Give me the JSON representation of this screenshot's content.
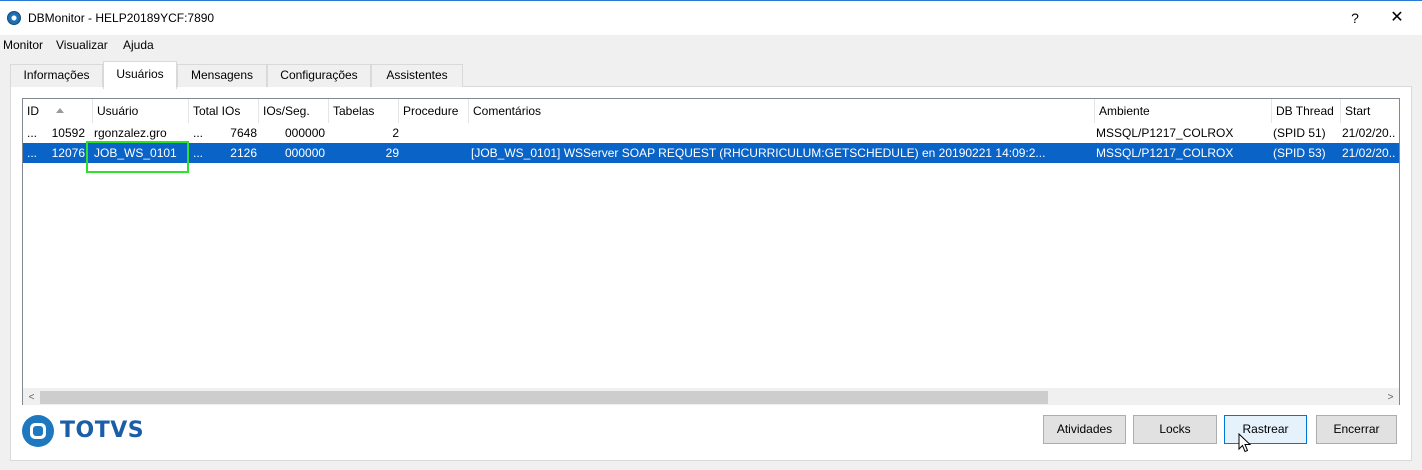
{
  "window": {
    "title": "DBMonitor - HELP20189YCF:7890",
    "help_label": "?",
    "close_label": "✕"
  },
  "menu": [
    "Monitor",
    "Visualizar",
    "Ajuda"
  ],
  "tabs": [
    {
      "label": "Informações",
      "active": false
    },
    {
      "label": "Usuários",
      "active": true
    },
    {
      "label": "Mensagens",
      "active": false
    },
    {
      "label": "Configurações",
      "active": false
    },
    {
      "label": "Assistentes",
      "active": false
    }
  ],
  "table": {
    "columns": [
      "ID",
      "Usuário",
      "Total IOs",
      "IOs/Seg.",
      "Tabelas",
      "Procedure",
      "Comentários",
      "Ambiente",
      "DB Thread",
      "Start"
    ],
    "rows": [
      {
        "prefix": "...",
        "id": "10592",
        "usuario": "rgonzalez.gro",
        "total_prefix": "...",
        "total_ios": "7648",
        "ios_seg": "000000",
        "tabelas": "2",
        "procedure": "",
        "comentarios": "",
        "ambiente": "MSSQL/P1217_COLROX",
        "db_thread": "(SPID 51)",
        "start": "21/02/20..",
        "selected": false
      },
      {
        "prefix": "...",
        "id": "12076",
        "usuario": "JOB_WS_0101",
        "total_prefix": "...",
        "total_ios": "2126",
        "ios_seg": "000000",
        "tabelas": "29",
        "procedure": "",
        "comentarios": "[JOB_WS_0101] WSServer SOAP REQUEST (RHCURRICULUM:GETSCHEDULE) en 20190221 14:09:2...",
        "ambiente": "MSSQL/P1217_COLROX",
        "db_thread": "(SPID 53)",
        "start": "21/02/20..",
        "selected": true
      }
    ]
  },
  "scrollbar": {
    "left_arrow": "<",
    "right_arrow": ">"
  },
  "logo": {
    "text": "TOTVS"
  },
  "buttons": [
    "Atividades",
    "Locks",
    "Rastrear",
    "Encerrar"
  ],
  "colors": {
    "selection": "#0a64c8",
    "highlight_box": "#2fe02f",
    "brand": "#1e78c0"
  }
}
